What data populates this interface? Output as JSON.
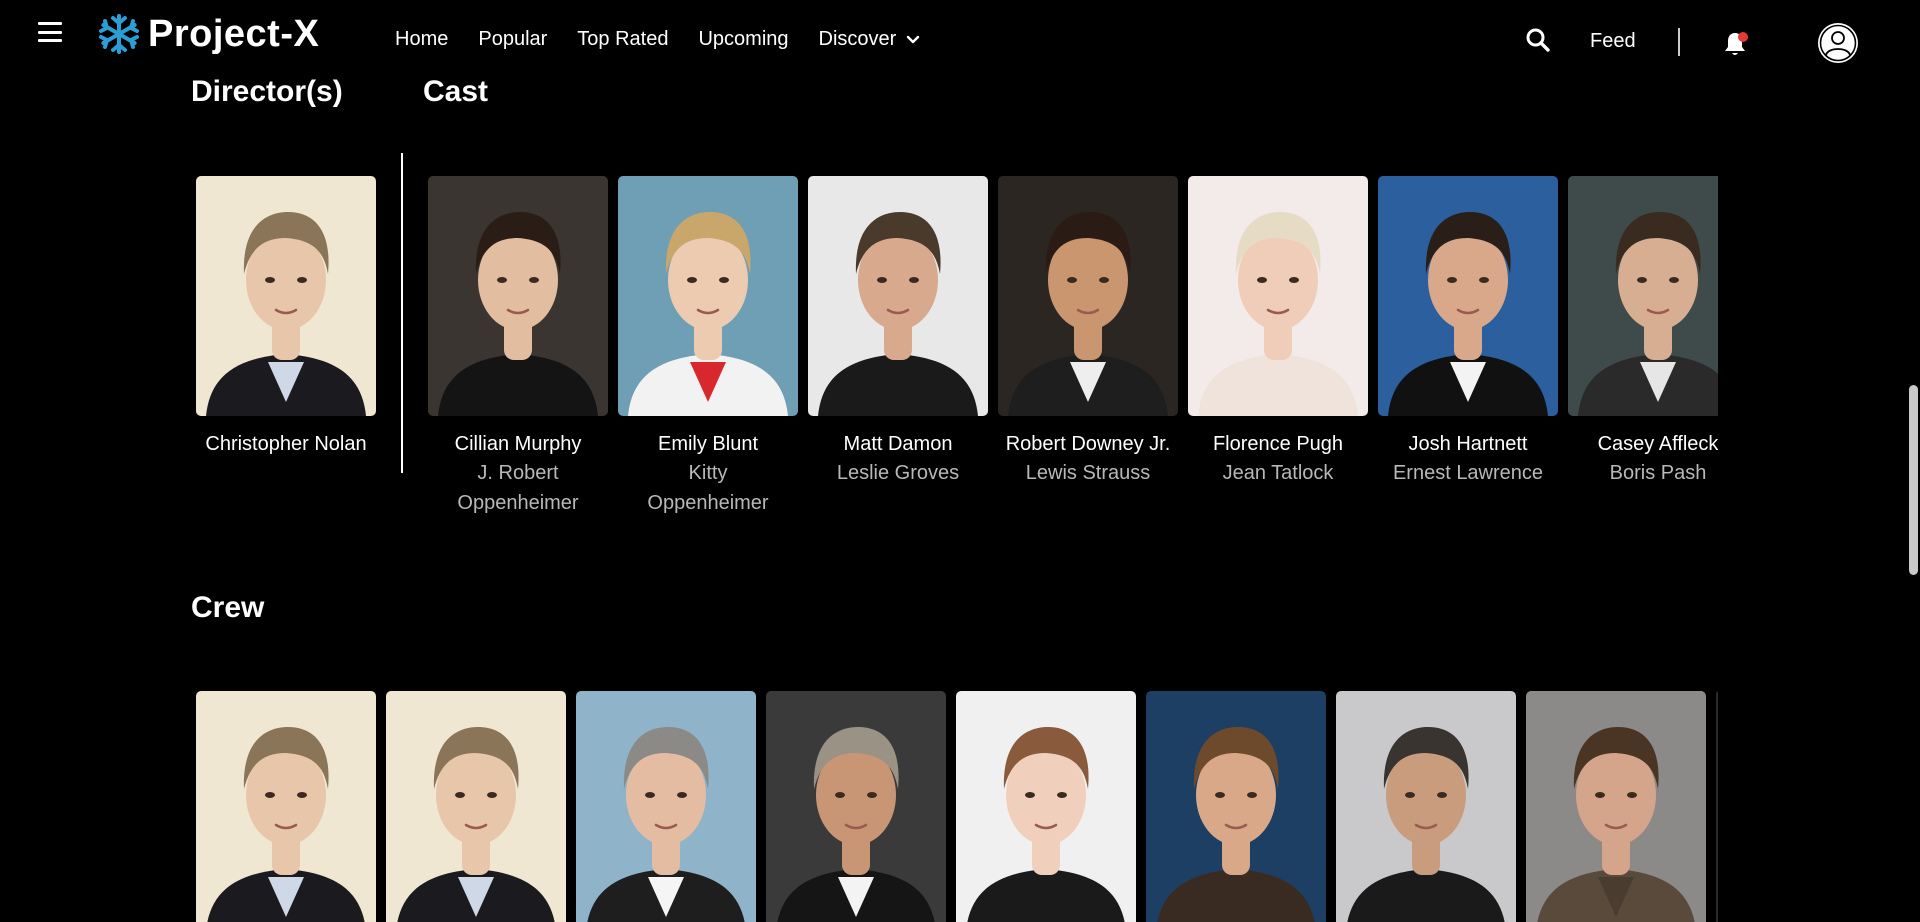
{
  "nav": {
    "logo_text": "Project-X",
    "links": [
      "Home",
      "Popular",
      "Top Rated",
      "Upcoming"
    ],
    "discover_label": "Discover",
    "feed_label": "Feed",
    "icons": [
      "menu-icon",
      "snowflake-logo-icon",
      "chevron-down-icon",
      "search-icon",
      "bell-icon",
      "user-avatar-icon"
    ],
    "accent_color": "#2a9fd6",
    "notification_dot_color": "#e53935"
  },
  "directors": {
    "title": "Director(s)",
    "people": [
      {
        "name": "Christopher Nolan",
        "bg": "#efe7d2",
        "shirt": "#cfd8e6",
        "suit": "#1b1b1f",
        "hair": "#8a7558",
        "skin": "#e8c6aa"
      }
    ]
  },
  "cast": {
    "title": "Cast",
    "people": [
      {
        "name": "Cillian Murphy",
        "role": "J. Robert Oppenheimer",
        "bg": "#3b3531",
        "shirt": "#141414",
        "suit": "#141414",
        "hair": "#2a1d15",
        "skin": "#e2bda0"
      },
      {
        "name": "Emily Blunt",
        "role": "Kitty Oppenheimer",
        "bg": "#6f9fb4",
        "shirt": "#d9282d",
        "suit": "#f2f2f2",
        "hair": "#c9a66a",
        "skin": "#edcbb0"
      },
      {
        "name": "Matt Damon",
        "role": "Leslie Groves",
        "bg": "#e8e8e8",
        "shirt": "#1a1a1a",
        "suit": "#1a1a1a",
        "hair": "#4a3a2c",
        "skin": "#d8a98c"
      },
      {
        "name": "Robert Downey Jr.",
        "role": "Lewis Strauss",
        "bg": "#2b2622",
        "shirt": "#eeeeee",
        "suit": "#1e1e1e",
        "hair": "#2a1c14",
        "skin": "#c9966f"
      },
      {
        "name": "Florence Pugh",
        "role": "Jean Tatlock",
        "bg": "#f2ebe9",
        "shirt": "#efe3dc",
        "suit": "#efe3dc",
        "hair": "#e6dcc6",
        "skin": "#f0cdb8"
      },
      {
        "name": "Josh Hartnett",
        "role": "Ernest Lawrence",
        "bg": "#2b5f9e",
        "shirt": "#f3f3f3",
        "suit": "#111111",
        "hair": "#2a1f18",
        "skin": "#d9a88a"
      },
      {
        "name": "Casey Affleck",
        "role": "Boris Pash",
        "bg": "#3f4a4a",
        "shirt": "#e6e6e6",
        "suit": "#2a2a2a",
        "hair": "#3a2b20",
        "skin": "#d8ae92"
      }
    ]
  },
  "crew": {
    "title": "Crew",
    "people": [
      {
        "bg": "#efe7d2",
        "shirt": "#cfd8e6",
        "suit": "#1b1b1f",
        "hair": "#8a7558",
        "skin": "#e8c6aa"
      },
      {
        "bg": "#efe7d2",
        "shirt": "#cfd8e6",
        "suit": "#1b1b1f",
        "hair": "#8a7558",
        "skin": "#e8c6aa"
      },
      {
        "bg": "#8fb3c9",
        "shirt": "#f5f5f5",
        "suit": "#1e1e1e",
        "hair": "#8c8a86",
        "skin": "#e3bca2"
      },
      {
        "bg": "#3a3a3a",
        "shirt": "#f3f3f3",
        "suit": "#151515",
        "hair": "#9a9285",
        "skin": "#c99675"
      },
      {
        "bg": "#f0f0f0",
        "shirt": "#1a1a1a",
        "suit": "#1a1a1a",
        "hair": "#8a5a3c",
        "skin": "#f0d0bc"
      },
      {
        "bg": "#1d3f63",
        "shirt": "#3a2b22",
        "suit": "#3a2b22",
        "hair": "#6e4a2c",
        "skin": "#d8a889"
      },
      {
        "bg": "#c9c9cb",
        "shirt": "#1a1a1a",
        "suit": "#1a1a1a",
        "hair": "#3a3430",
        "skin": "#c99c7e"
      },
      {
        "bg": "#8c8a88",
        "shirt": "#4a3c30",
        "suit": "#5a4a3c",
        "hair": "#4a3424",
        "skin": "#d4a58a"
      }
    ]
  }
}
